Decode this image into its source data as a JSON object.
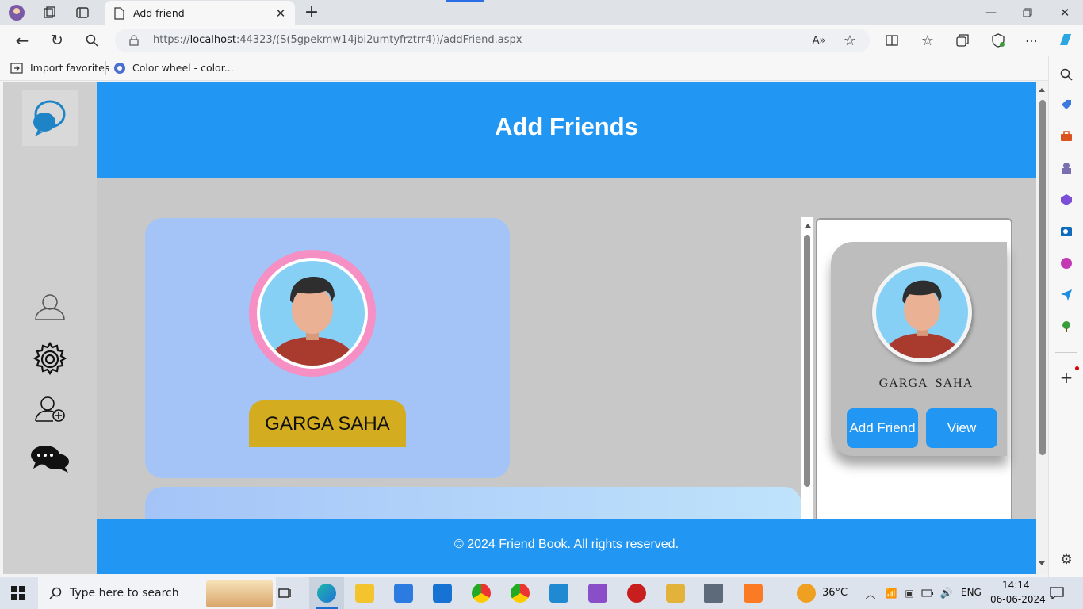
{
  "browser": {
    "tab_title": "Add friend",
    "url_prefix": "https://",
    "url_host": "localhost",
    "url_rest": ":44323/(S(5gpekmw14jbi2umtyfrztrr4))/addFriend.aspx"
  },
  "favorites": [
    {
      "label": "Import favorites"
    },
    {
      "label": "Color wheel - color..."
    }
  ],
  "page": {
    "header_title": "Add Friends",
    "footer_text": "© 2024 Friend Book. All rights reserved."
  },
  "card": {
    "name": "GARGA SAHA"
  },
  "panel": {
    "name": "GARGA  SAHA",
    "add_label": "Add Friend",
    "view_label": "View"
  },
  "taskbar": {
    "search_placeholder": "Type here to search",
    "weather": "36°C",
    "lang": "ENG",
    "time": "14:14",
    "date": "06-06-2024"
  },
  "colors": {
    "accent": "#2196f3",
    "card": "#a4c4f8",
    "pill": "#d4ac1f",
    "ring": "#f58fc4"
  }
}
